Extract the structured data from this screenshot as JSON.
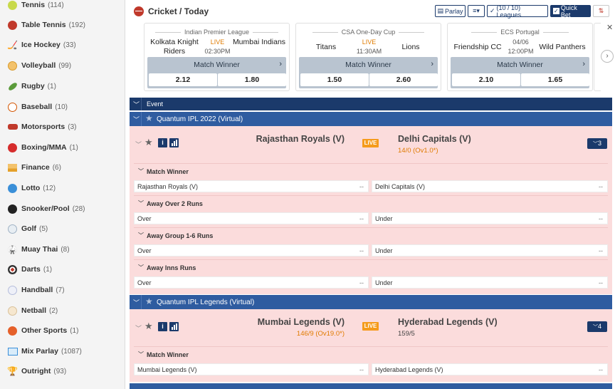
{
  "sidebar": {
    "items": [
      {
        "label": "Tennis",
        "count": "(114)",
        "icon": "tennis-icon"
      },
      {
        "label": "Table Tennis",
        "count": "(192)",
        "icon": "table-tennis-icon"
      },
      {
        "label": "Ice Hockey",
        "count": "(33)",
        "icon": "ice-hockey-icon"
      },
      {
        "label": "Volleyball",
        "count": "(99)",
        "icon": "volleyball-icon"
      },
      {
        "label": "Rugby",
        "count": "(1)",
        "icon": "rugby-icon"
      },
      {
        "label": "Baseball",
        "count": "(10)",
        "icon": "baseball-icon"
      },
      {
        "label": "Motorsports",
        "count": "(3)",
        "icon": "motorsports-icon"
      },
      {
        "label": "Boxing/MMA",
        "count": "(1)",
        "icon": "boxing-icon"
      },
      {
        "label": "Finance",
        "count": "(6)",
        "icon": "finance-icon"
      },
      {
        "label": "Lotto",
        "count": "(12)",
        "icon": "lotto-icon"
      },
      {
        "label": "Snooker/Pool",
        "count": "(28)",
        "icon": "snooker-icon"
      },
      {
        "label": "Golf",
        "count": "(5)",
        "icon": "golf-icon"
      },
      {
        "label": "Muay Thai",
        "count": "(8)",
        "icon": "muay-thai-icon"
      },
      {
        "label": "Darts",
        "count": "(1)",
        "icon": "darts-icon"
      },
      {
        "label": "Handball",
        "count": "(7)",
        "icon": "handball-icon"
      },
      {
        "label": "Netball",
        "count": "(2)",
        "icon": "netball-icon"
      },
      {
        "label": "Other Sports",
        "count": "(1)",
        "icon": "other-sports-icon"
      },
      {
        "label": "Mix Parlay",
        "count": "(1087)",
        "icon": "mix-parlay-icon"
      },
      {
        "label": "Outright",
        "count": "(93)",
        "icon": "outright-icon"
      }
    ]
  },
  "header": {
    "title": "Cricket / Today",
    "parlay_label": "Parlay",
    "leagues_label": "(10 / 10) Leagues",
    "quickbet_label": "Quick Bet"
  },
  "featured": [
    {
      "league": "Indian Premier League",
      "home": "Kolkata Knight Riders",
      "away": "Mumbai Indians",
      "status": "LIVE",
      "time": "02:30PM",
      "market": "Match Winner",
      "odd_home": "2.12",
      "odd_away": "1.80"
    },
    {
      "league": "CSA One-Day Cup",
      "home": "Titans",
      "away": "Lions",
      "status": "LIVE",
      "time": "11:30AM",
      "market": "Match Winner",
      "odd_home": "1.50",
      "odd_away": "2.60"
    },
    {
      "league": "ECS Portugal",
      "home": "Friendship CC",
      "away": "Wild Panthers",
      "status": "04/06",
      "time": "12:00PM",
      "market": "Match Winner",
      "odd_home": "2.10",
      "odd_away": "1.65"
    }
  ],
  "event_header": "Event",
  "leagues": [
    {
      "name": "Quantum IPL 2022 (Virtual)",
      "match": {
        "team_a": "Rajasthan Royals (V)",
        "team_b": "Delhi Capitals (V)",
        "live": "LIVE",
        "score_b": "14/0 (Ov1.0*)",
        "more": "3"
      },
      "markets": [
        {
          "name": "Match Winner",
          "left": "Rajasthan Royals (V)",
          "left_val": "--",
          "right": "Delhi Capitals (V)",
          "right_val": "--"
        },
        {
          "name": "Away Over 2 Runs",
          "left": "Over",
          "left_val": "--",
          "right": "Under",
          "right_val": "--"
        },
        {
          "name": "Away Group 1-6 Runs",
          "left": "Over",
          "left_val": "--",
          "right": "Under",
          "right_val": "--"
        },
        {
          "name": "Away Inns Runs",
          "left": "Over",
          "left_val": "--",
          "right": "Under",
          "right_val": "--"
        }
      ]
    },
    {
      "name": "Quantum IPL Legends (Virtual)",
      "match": {
        "team_a": "Mumbai Legends (V)",
        "team_b": "Hyderabad Legends (V)",
        "live": "LIVE",
        "score_a": "146/9 (Ov19.0*)",
        "score_b": "159/5",
        "more": "4"
      },
      "markets": [
        {
          "name": "Match Winner",
          "left": "Mumbai Legends (V)",
          "left_val": "--",
          "right": "Hyderabad Legends (V)",
          "right_val": "--"
        }
      ]
    }
  ]
}
